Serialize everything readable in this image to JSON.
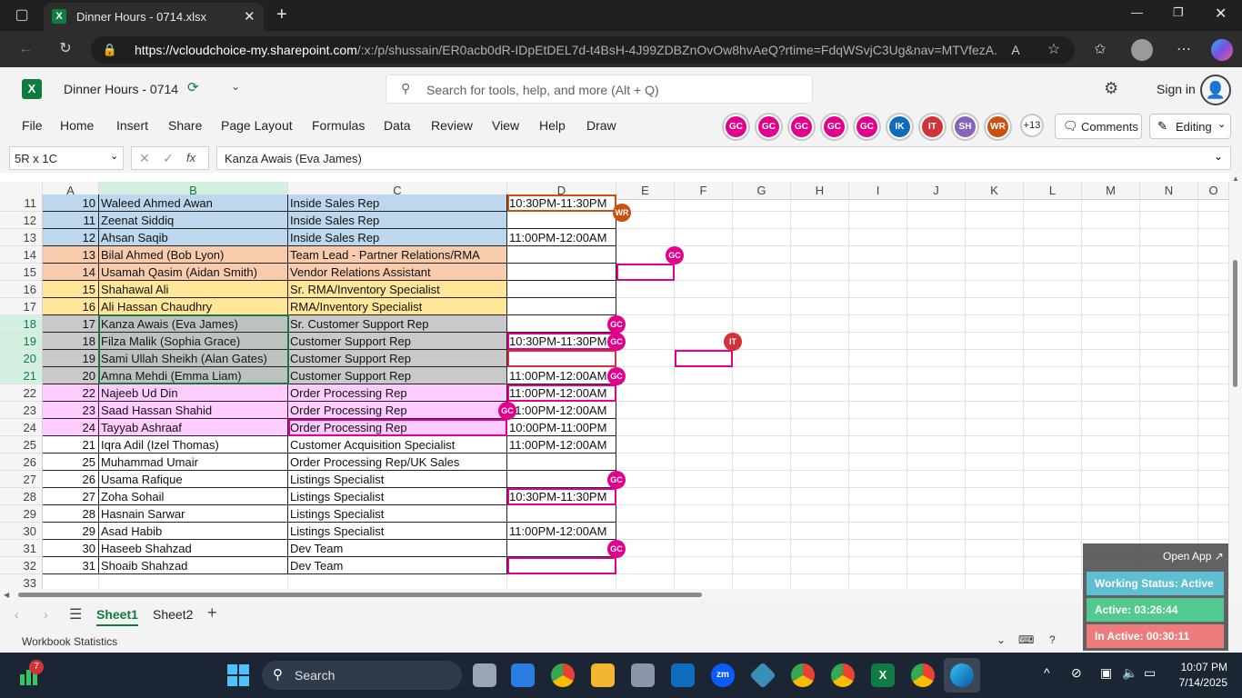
{
  "browser": {
    "tab_title": "Dinner Hours - 0714.xlsx",
    "url_domain": "https://vcloudchoice-my.sharepoint.com",
    "url_path": "/:x:/p/shussain/ER0acb0dR-IDpEtDEL7d-t4BsH-4J99ZDBZnOvOw8hvAeQ?rtime=FdqWSvjC3Ug&nav=MTVfezA..."
  },
  "excel": {
    "file_name": "Dinner Hours - 0714",
    "search_placeholder": "Search for tools, help, and more (Alt + Q)",
    "sign_in": "Sign in",
    "menu": [
      "File",
      "Home",
      "Insert",
      "Share",
      "Page Layout",
      "Formulas",
      "Data",
      "Review",
      "View",
      "Help",
      "Draw"
    ],
    "collaborators": [
      {
        "initials": "GC",
        "color": "#e3008c"
      },
      {
        "initials": "GC",
        "color": "#e3008c"
      },
      {
        "initials": "GC",
        "color": "#e3008c"
      },
      {
        "initials": "GC",
        "color": "#e3008c"
      },
      {
        "initials": "GC",
        "color": "#e3008c"
      },
      {
        "initials": "IK",
        "color": "#0f6cbd"
      },
      {
        "initials": "IT",
        "color": "#d13438"
      },
      {
        "initials": "SH",
        "color": "#8764b8"
      },
      {
        "initials": "WR",
        "color": "#ca5010"
      }
    ],
    "more_collaborators": "+13",
    "comments_label": "Comments",
    "editing_label": "Editing",
    "name_box": "5R x 1C",
    "fx_label": "fx",
    "formula_value": "Kanza Awais (Eva James)"
  },
  "grid": {
    "columns": [
      "A",
      "B",
      "C",
      "D",
      "E",
      "F",
      "G",
      "H",
      "I",
      "J",
      "K",
      "L",
      "M",
      "N",
      "O"
    ],
    "rows": [
      {
        "num": "11",
        "a": "10",
        "b": "Waleed Ahmed Awan",
        "c": "Inside Sales Rep",
        "d": "10:30PM-11:30PM",
        "fill": "#bdd7ee"
      },
      {
        "num": "12",
        "a": "11",
        "b": "Zeenat Siddiq",
        "c": "Inside Sales Rep",
        "d": "",
        "fill": "#bdd7ee"
      },
      {
        "num": "13",
        "a": "12",
        "b": "Ahsan Saqib",
        "c": "Inside Sales Rep",
        "d": "11:00PM-12:00AM",
        "fill": "#bdd7ee"
      },
      {
        "num": "14",
        "a": "13",
        "b": "Bilal Ahmed (Bob Lyon)",
        "c": "Team Lead - Partner Relations/RMA",
        "d": "",
        "fill": "#f8cbad"
      },
      {
        "num": "15",
        "a": "14",
        "b": "Usamah Qasim (Aidan Smith)",
        "c": "Vendor Relations Assistant",
        "d": "",
        "fill": "#f8cbad"
      },
      {
        "num": "16",
        "a": "15",
        "b": "Shahawal Ali",
        "c": "Sr. RMA/Inventory Specialist",
        "d": "",
        "fill": "#ffe699"
      },
      {
        "num": "17",
        "a": "16",
        "b": "Ali Hassan Chaudhry",
        "c": "RMA/Inventory Specialist",
        "d": "",
        "fill": "#ffe699"
      },
      {
        "num": "18",
        "a": "17",
        "b": "Kanza Awais (Eva James)",
        "c": "Sr. Customer Support Rep",
        "d": "",
        "fill": "#c9c9c9"
      },
      {
        "num": "19",
        "a": "18",
        "b": "Filza Malik (Sophia Grace)",
        "c": "Customer Support Rep",
        "d": "10:30PM-11:30PM",
        "fill": "#c9c9c9"
      },
      {
        "num": "20",
        "a": "19",
        "b": "Sami Ullah Sheikh (Alan Gates)",
        "c": "Customer Support Rep",
        "d": "",
        "fill": "#c9c9c9"
      },
      {
        "num": "21",
        "a": "20",
        "b": "Amna Mehdi (Emma Liam)",
        "c": "Customer Support Rep",
        "d": "11:00PM-12:00AM",
        "fill": "#c9c9c9"
      },
      {
        "num": "22",
        "a": "22",
        "b": "Najeeb Ud Din",
        "c": "Order Processing Rep",
        "d": "11:00PM-12:00AM",
        "fill": "#ffccff"
      },
      {
        "num": "23",
        "a": "23",
        "b": "Saad Hassan Shahid",
        "c": "Order Processing Rep",
        "d": "11:00PM-12:00AM",
        "fill": "#ffccff"
      },
      {
        "num": "24",
        "a": "24",
        "b": "Tayyab Ashraaf",
        "c": "Order Processing Rep",
        "d": "10:00PM-11:00PM",
        "fill": "#ffccff"
      },
      {
        "num": "25",
        "a": "21",
        "b": "Iqra Adil (Izel Thomas)",
        "c": "Customer Acquisition Specialist",
        "d": "11:00PM-12:00AM",
        "fill": "#ffffff"
      },
      {
        "num": "26",
        "a": "25",
        "b": "Muhammad Umair",
        "c": "Order Processing Rep/UK Sales",
        "d": "",
        "fill": "#ffffff"
      },
      {
        "num": "27",
        "a": "26",
        "b": "Usama Rafique",
        "c": "Listings Specialist",
        "d": "",
        "fill": "#ffffff"
      },
      {
        "num": "28",
        "a": "27",
        "b": "Zoha Sohail",
        "c": "Listings Specialist",
        "d": "10:30PM-11:30PM",
        "fill": "#ffffff"
      },
      {
        "num": "29",
        "a": "28",
        "b": "Hasnain Sarwar",
        "c": "Listings Specialist",
        "d": "",
        "fill": "#ffffff"
      },
      {
        "num": "30",
        "a": "29",
        "b": "Asad Habib",
        "c": "Listings Specialist",
        "d": "11:00PM-12:00AM",
        "fill": "#ffffff"
      },
      {
        "num": "31",
        "a": "30",
        "b": "Haseeb Shahzad",
        "c": "Dev Team",
        "d": "",
        "fill": "#ffffff"
      },
      {
        "num": "32",
        "a": "31",
        "b": "Shoaib Shahzad",
        "c": "Dev Team",
        "d": "",
        "fill": "#ffffff"
      },
      {
        "num": "33",
        "a": "",
        "b": "",
        "c": "",
        "d": "",
        "fill": "none"
      }
    ],
    "presence_tags": [
      {
        "initials": "WR",
        "color": "#ca5010"
      },
      {
        "initials": "GC",
        "color": "#e3008c"
      },
      {
        "initials": "GC",
        "color": "#e3008c"
      },
      {
        "initials": "IT",
        "color": "#d13438"
      },
      {
        "initials": "GC",
        "color": "#e3008c"
      },
      {
        "initials": "GC",
        "color": "#e3008c"
      },
      {
        "initials": "GC",
        "color": "#e3008c"
      },
      {
        "initials": "GC",
        "color": "#e3008c"
      },
      {
        "initials": "GC",
        "color": "#e3008c"
      }
    ]
  },
  "sheets": {
    "tabs": [
      "Sheet1",
      "Sheet2"
    ],
    "active": "Sheet1"
  },
  "status": {
    "left": "Workbook Statistics"
  },
  "widget": {
    "open_app": "Open App ↗",
    "working_status": "Working Status: Active",
    "active": "Active: 03:26:44",
    "inactive": "In Active: 00:30:11"
  },
  "taskbar": {
    "search": "Search",
    "badge": "7",
    "time": "10:07 PM",
    "date": "7/14/2025"
  },
  "colors": {
    "excel_green": "#107c41",
    "selection": "#217346",
    "presence_pink": "#e3008c"
  }
}
